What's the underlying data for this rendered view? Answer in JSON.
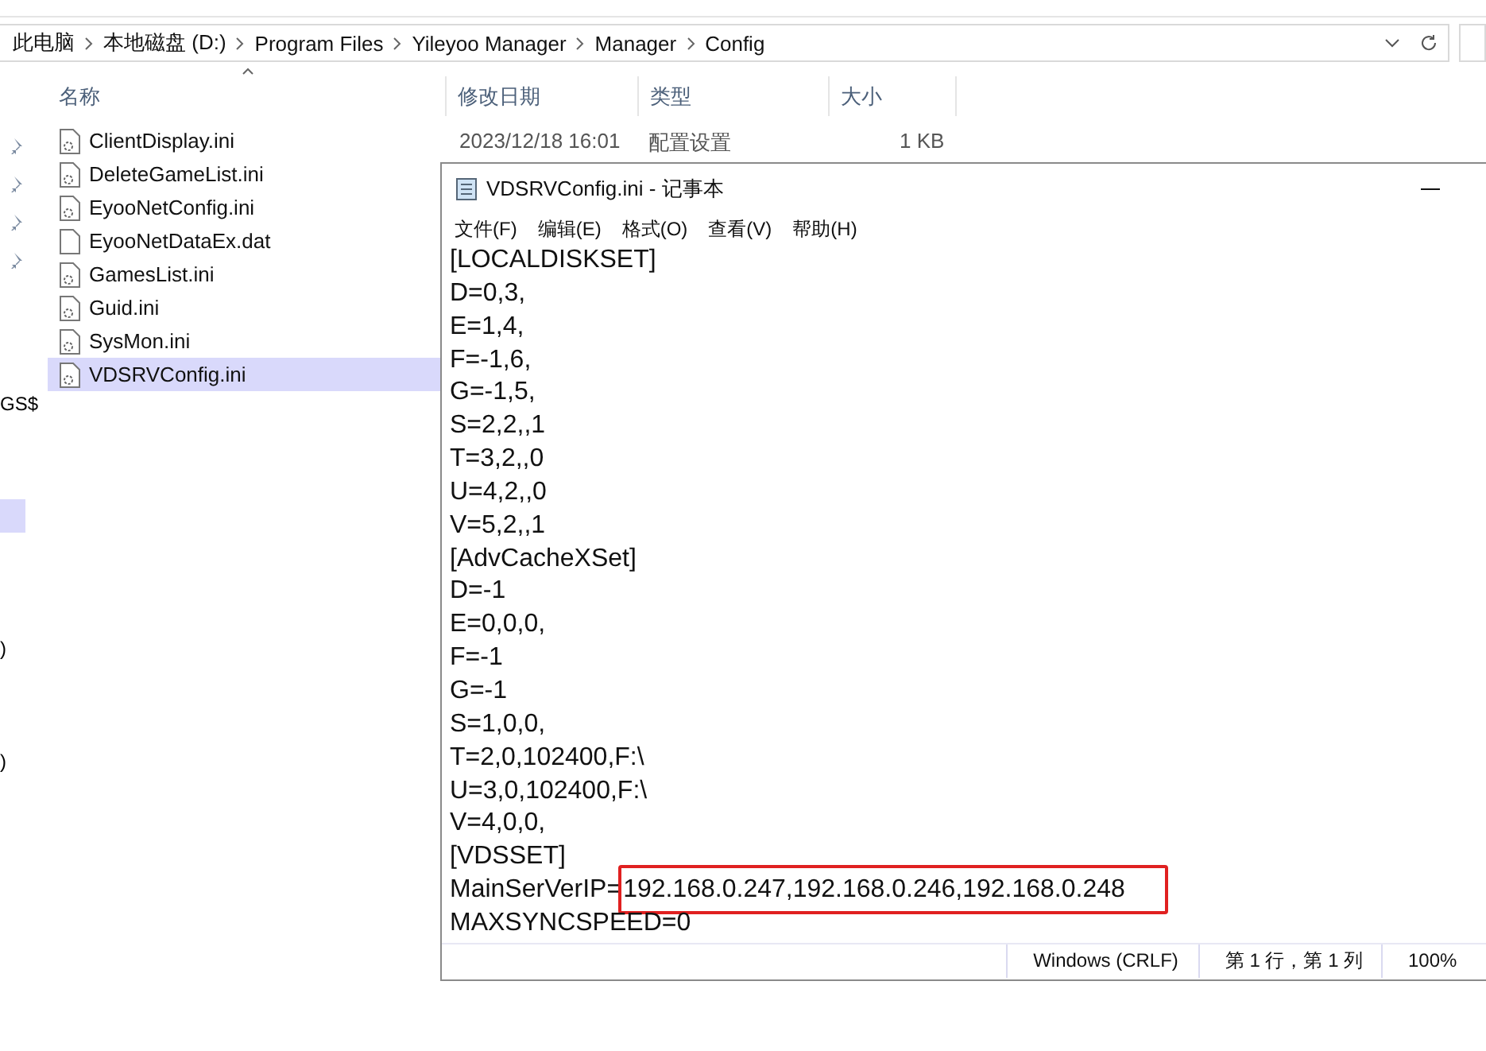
{
  "explorer": {
    "breadcrumb": [
      "此电脑",
      "本地磁盘 (D:)",
      "Program Files",
      "Yileyoo Manager",
      "Manager",
      "Config"
    ],
    "columns": [
      "名称",
      "修改日期",
      "类型",
      "大小"
    ],
    "nav_fragments": [
      {
        "text": "GS$",
        "selected": false
      },
      {
        "selected": true
      },
      {
        "text": ")",
        "selected": false
      },
      {
        "text": ")",
        "selected": false
      }
    ],
    "files": [
      {
        "name": "ClientDisplay.ini",
        "kind": "ini",
        "selected": false,
        "date": "2023/12/18 16:01",
        "type": "配置设置",
        "size": "1 KB"
      },
      {
        "name": "DeleteGameList.ini",
        "kind": "ini",
        "selected": false
      },
      {
        "name": "EyooNetConfig.ini",
        "kind": "ini",
        "selected": false
      },
      {
        "name": "EyooNetDataEx.dat",
        "kind": "dat",
        "selected": false
      },
      {
        "name": "GamesList.ini",
        "kind": "ini",
        "selected": false
      },
      {
        "name": "Guid.ini",
        "kind": "ini",
        "selected": false
      },
      {
        "name": "SysMon.ini",
        "kind": "ini",
        "selected": false
      },
      {
        "name": "VDSRVConfig.ini",
        "kind": "ini",
        "selected": true
      }
    ]
  },
  "notepad": {
    "title": "VDSRVConfig.ini - 记事本",
    "menu": [
      "文件(F)",
      "编辑(E)",
      "格式(O)",
      "查看(V)",
      "帮助(H)"
    ],
    "lines": [
      {
        "text": "[LOCALDISKSET]"
      },
      {
        "text": "D=0,3,"
      },
      {
        "text": "E=1,4,"
      },
      {
        "text": "F=-1,6,"
      },
      {
        "text": "G=-1,5,"
      },
      {
        "text": "S=2,2,,1"
      },
      {
        "text": "T=3,2,,0"
      },
      {
        "text": "U=4,2,,0"
      },
      {
        "text": "V=5,2,,1"
      },
      {
        "text": "[AdvCacheXSet]"
      },
      {
        "text": "D=-1"
      },
      {
        "text": "E=0,0,0,"
      },
      {
        "text": "F=-1"
      },
      {
        "text": "G=-1"
      },
      {
        "text": "S=1,0,0,"
      },
      {
        "text": "T=2,0,102400,F:\\"
      },
      {
        "text": "U=3,0,102400,F:\\"
      },
      {
        "text": "V=4,0,0,"
      },
      {
        "text": "[VDSSET]"
      },
      {
        "text": "MainSerVerIP=",
        "boxed_text": "192.168.0.247,192.168.0.246,192.168.0.248"
      },
      {
        "text": "MAXSYNCSPEED=0"
      }
    ],
    "status": [
      "Windows (CRLF)",
      "第 1 行，第 1 列",
      "100%"
    ]
  }
}
